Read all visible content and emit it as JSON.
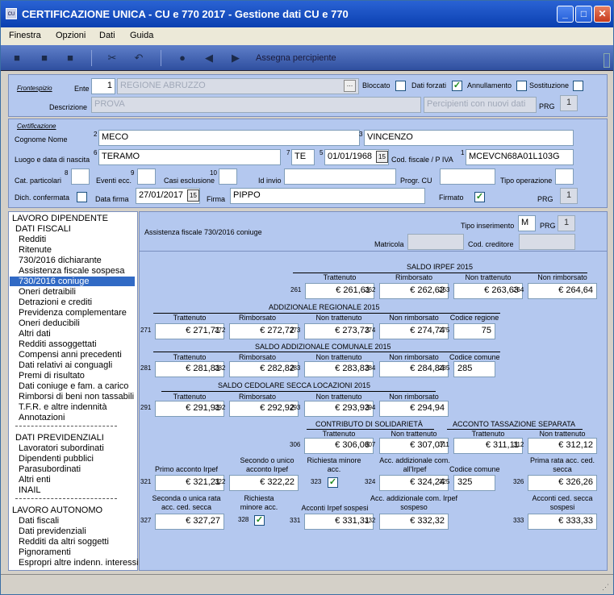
{
  "window": {
    "title": "CERTIFICAZIONE UNICA  -  CU e 770 2017 - Gestione dati CU e 770",
    "icon_text": "CU"
  },
  "menu": [
    "Finestra",
    "Opzioni",
    "Dati",
    "Guida"
  ],
  "toolbar": {
    "label": "Assegna percipiente"
  },
  "frontespizio": {
    "title": "Frontespizio",
    "ente_label": "Ente",
    "ente_code": "1",
    "ente_name": "REGIONE ABRUZZO",
    "bloccato_label": "Bloccato",
    "dati_forzati_label": "Dati forzati",
    "annullamento_label": "Annullamento",
    "sostituzione_label": "Sostituzione",
    "descrizione_label": "Descrizione",
    "descrizione": "PROVA",
    "percipienti_placeholder": "Percipienti con nuovi dati",
    "prg_label": "PRG",
    "prg": "1"
  },
  "certificazione": {
    "title": "Certificazione",
    "cognome_nome_label": "Cognome Nome",
    "n2": "2",
    "cognome": "MECO",
    "n3": "3",
    "nome": "VINCENZO",
    "luogo_label": "Luogo e data di nascita",
    "n6": "6",
    "luogo": "TERAMO",
    "n7": "7",
    "prov": "TE",
    "n5": "5",
    "data_nascita": "01/01/1968",
    "cf_label": "Cod. fiscale / P IVA",
    "n1": "1",
    "cf": "MCEVCN68A01L103G",
    "cat_label": "Cat. particolari",
    "n8": "8",
    "eventi_label": "Eventi ecc.",
    "n9": "9",
    "casi_label": "Casi esclusione",
    "n10": "10",
    "id_invio_label": "Id invio",
    "progr_cu_label": "Progr. CU",
    "tipo_op_label": "Tipo operazione",
    "dich_label": "Dich. confermata",
    "data_firma_label": "Data firma",
    "data_firma": "27/01/2017",
    "firma_label": "Firma",
    "firma": "PIPPO",
    "firmato_label": "Firmato",
    "prg_label": "PRG",
    "prg": "1"
  },
  "sidebar": {
    "items": [
      {
        "t": "LAVORO DIPENDENTE",
        "k": "hdr"
      },
      {
        "t": "DATI FISCALI",
        "k": "hdr2"
      },
      {
        "t": "Redditi",
        "k": "it"
      },
      {
        "t": "Ritenute",
        "k": "it"
      },
      {
        "t": "730/2016 dichiarante",
        "k": "it"
      },
      {
        "t": "Assistenza fiscale sospesa",
        "k": "it"
      },
      {
        "t": "730/2016 coniuge",
        "k": "sel"
      },
      {
        "t": "Oneri detraibili",
        "k": "it"
      },
      {
        "t": "Detrazioni e crediti",
        "k": "it"
      },
      {
        "t": "Previdenza complementare",
        "k": "it"
      },
      {
        "t": "Oneri deducibili",
        "k": "it"
      },
      {
        "t": "Altri dati",
        "k": "it"
      },
      {
        "t": "Redditi assoggettati",
        "k": "it"
      },
      {
        "t": "Compensi anni precedenti",
        "k": "it"
      },
      {
        "t": "Dati relativi ai conguagli",
        "k": "it"
      },
      {
        "t": "Premi di risultato",
        "k": "it"
      },
      {
        "t": "Dati coniuge e fam. a carico",
        "k": "it"
      },
      {
        "t": "Rimborsi di beni non tassabili",
        "k": "it"
      },
      {
        "t": "T.F.R. e altre indennità",
        "k": "it"
      },
      {
        "t": "Annotazioni",
        "k": "it"
      },
      {
        "t": "DATI PREVIDENZIALI",
        "k": "hdr2"
      },
      {
        "t": "Lavoratori subordinati",
        "k": "it"
      },
      {
        "t": "Dipendenti pubblici",
        "k": "it"
      },
      {
        "t": "Parasubordinati",
        "k": "it"
      },
      {
        "t": "Altri enti",
        "k": "it"
      },
      {
        "t": "INAIL",
        "k": "it"
      },
      {
        "t": "LAVORO AUTONOMO",
        "k": "hdr"
      },
      {
        "t": "Dati fiscali",
        "k": "it"
      },
      {
        "t": "Dati previdenziali",
        "k": "it"
      },
      {
        "t": "Redditi da altri soggetti",
        "k": "it"
      },
      {
        "t": "Pignoramenti",
        "k": "it"
      },
      {
        "t": "Espropri altre indenn. interessi",
        "k": "it"
      }
    ]
  },
  "main": {
    "subtitle": "Assistenza fiscale 730/2016 coniuge",
    "tipo_ins_label": "Tipo inserimento",
    "tipo_ins": "M",
    "prg_label": "PRG",
    "prg": "1",
    "matricola_label": "Matricola",
    "cod_creditore_label": "Cod. creditore",
    "saldo_irpef": "SALDO IRPEF 2015",
    "add_reg": "ADDIZIONALE REGIONALE 2015",
    "saldo_add_com": "SALDO ADDIZIONALE COMUNALE 2015",
    "saldo_cedolare": "SALDO CEDOLARE SECCA LOCAZIONI 2015",
    "contributo": "CONTRIBUTO DI SOLIDARIETÀ",
    "acconto_tass": "ACCONTO TASSAZIONE SEPARATA",
    "lbl_trattenuto": "Trattenuto",
    "lbl_rimborsato": "Rimborsato",
    "lbl_non_trattenuto": "Non trattenuto",
    "lbl_non_rimborsato": "Non rimborsato",
    "lbl_codice_regione": "Codice regione",
    "lbl_codice_comune": "Codice comune",
    "lbl_primo_acconto": "Primo acconto Irpef",
    "lbl_secondo_unico": "Secondo o unico acconto Irpef",
    "lbl_richiesta": "Richiesta minore acc.",
    "lbl_acc_add_com": "Acc. addizionale com. all'Irpef",
    "lbl_prima_rata": "Prima rata acc. ced. secca",
    "lbl_seconda_rata": "Seconda o unica rata acc. ced. secca",
    "lbl_acconti_irpef_sosp": "Acconti Irpef sospesi",
    "lbl_acc_add_com_sosp": "Acc. addizionale com. Irpef sospeso",
    "lbl_acconti_ced_sosp": "Acconti ced. secca sospesi",
    "fields": {
      "261": "€ 261,61",
      "262": "€ 262,62",
      "263": "€ 263,63",
      "264": "€ 264,64",
      "271": "€ 271,71",
      "272": "€ 272,72",
      "273": "€ 273,73",
      "274": "€ 274,74",
      "275": "75",
      "281": "€ 281,81",
      "282": "€ 282,82",
      "283": "€ 283,83",
      "284": "€ 284,84",
      "285": "285",
      "291": "€ 291,91",
      "292": "€ 292,92",
      "293": "€ 293,93",
      "294": "€ 294,94",
      "306": "€ 306,06",
      "307": "€ 307,07",
      "311": "€ 311,11",
      "312": "€ 312,12",
      "321": "€ 321,21",
      "322": "€ 322,22",
      "324": "€ 324,24",
      "325": "325",
      "326": "€ 326,26",
      "327": "€ 327,27",
      "331": "€ 331,31",
      "332": "€ 332,32",
      "333": "€ 333,33"
    },
    "check": "✓"
  }
}
